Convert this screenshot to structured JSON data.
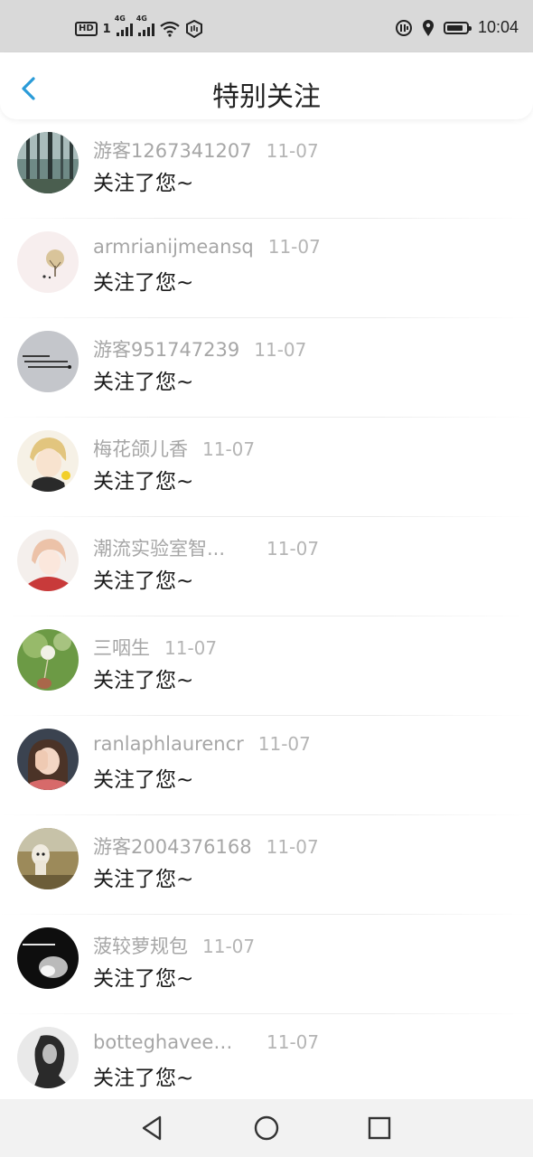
{
  "status": {
    "hd": "HD",
    "sim1": "1",
    "net1": "4G",
    "net2": "4G",
    "time": "10:04",
    "battery_level": 0.85
  },
  "header": {
    "title": "特别关注",
    "back_icon": "chevron-left-icon",
    "accent": "#2a9bd8"
  },
  "list": [
    {
      "name": "游客1267341207",
      "date": "11-07",
      "message": "关注了您~",
      "avatar": "forest-photo"
    },
    {
      "name": "armrianijmeansq",
      "date": "11-07",
      "message": "关注了您~",
      "avatar": "tree-doodle"
    },
    {
      "name": "游客951747239",
      "date": "11-07",
      "message": "关注了您~",
      "avatar": "text-on-gray"
    },
    {
      "name": "梅花颌儿香",
      "date": "11-07",
      "message": "关注了您~",
      "avatar": "anime-boy-blond"
    },
    {
      "name": "潮流实验室智...",
      "date": "11-07",
      "message": "关注了您~",
      "avatar": "anime-girl-red"
    },
    {
      "name": "三咽生",
      "date": "11-07",
      "message": "关注了您~",
      "avatar": "dandelion-photo"
    },
    {
      "name": "ranlaphlaurencr",
      "date": "11-07",
      "message": "关注了您~",
      "avatar": "girl-covering-face"
    },
    {
      "name": "游客2004376168",
      "date": "11-07",
      "message": "关注了您~",
      "avatar": "alpaca-photo"
    },
    {
      "name": "菠较萝规包",
      "date": "11-07",
      "message": "关注了您~",
      "avatar": "black-white-portrait"
    },
    {
      "name": "botteghaveen...",
      "date": "11-07",
      "message": "关注了您~",
      "avatar": "bw-man-portrait"
    }
  ],
  "bottom_nav": {
    "back": "triangle-back-icon",
    "home": "circle-home-icon",
    "recent": "square-recent-icon"
  }
}
